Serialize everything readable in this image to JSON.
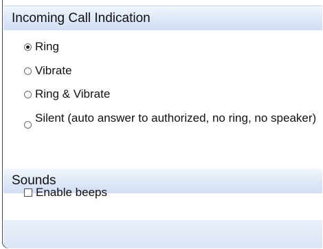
{
  "incoming_call": {
    "title": "Incoming Call Indication",
    "options": [
      {
        "label": "Ring",
        "selected": true
      },
      {
        "label": "Vibrate",
        "selected": false
      },
      {
        "label": "Ring & Vibrate",
        "selected": false
      },
      {
        "label": "Silent (auto answer to authorized, no ring, no speaker)",
        "selected": false
      }
    ]
  },
  "sounds": {
    "title": "Sounds",
    "enable_beeps": {
      "label": "Enable beeps",
      "checked": false
    }
  },
  "colors": {
    "header_gradient_top": "#f3f7fd",
    "header_gradient_bottom": "#d2def3",
    "border": "#4a4a4a"
  }
}
